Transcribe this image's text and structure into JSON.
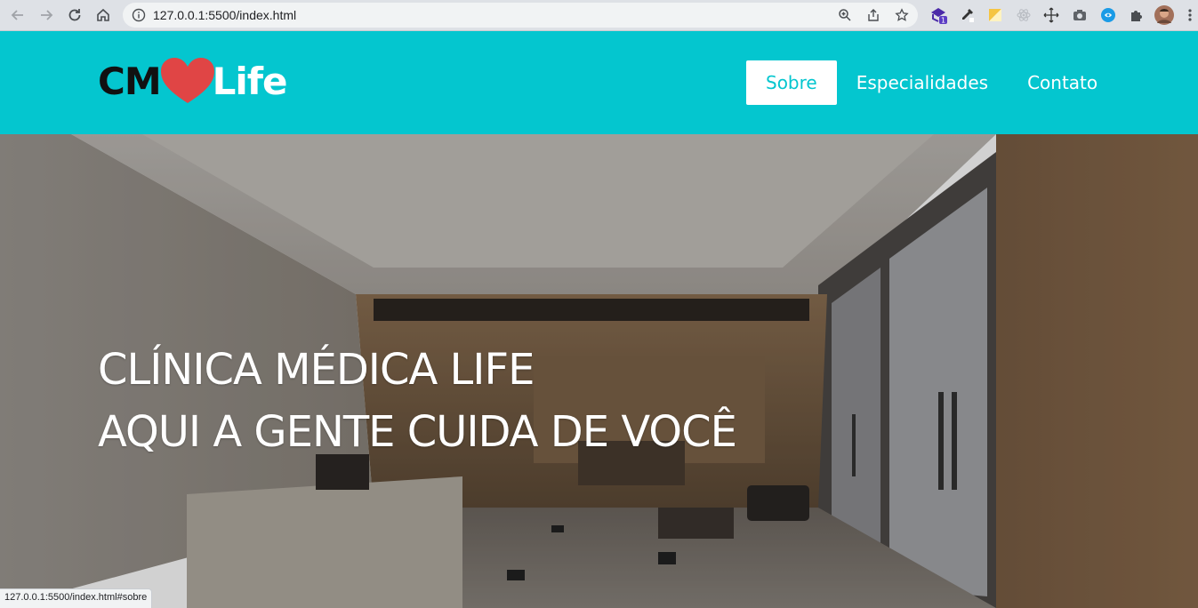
{
  "browser": {
    "url": "127.0.0.1:5500/index.html",
    "status_url": "127.0.0.1:5500/index.html#sobre",
    "extension_badge": "1",
    "icons": [
      "back-icon",
      "forward-icon",
      "reload-icon",
      "home-icon",
      "site-info-icon",
      "zoom-icon",
      "share-icon",
      "bookmark-star-icon",
      "extension-icon",
      "eyedropper-icon",
      "ruler-icon",
      "react-icon",
      "move-icon",
      "camera-icon",
      "vpn-icon",
      "puzzle-icon",
      "avatar",
      "menu-icon"
    ]
  },
  "header": {
    "logo_cm": "CM",
    "logo_life": "Life",
    "nav": [
      {
        "label": "Sobre",
        "active": true
      },
      {
        "label": "Especialidades",
        "active": false
      },
      {
        "label": "Contato",
        "active": false
      }
    ],
    "color": "#04c6cf"
  },
  "hero": {
    "line1": "CLÍNICA MÉDICA LIFE",
    "line2": "AQUI A GENTE CUIDA DE VOCÊ"
  }
}
